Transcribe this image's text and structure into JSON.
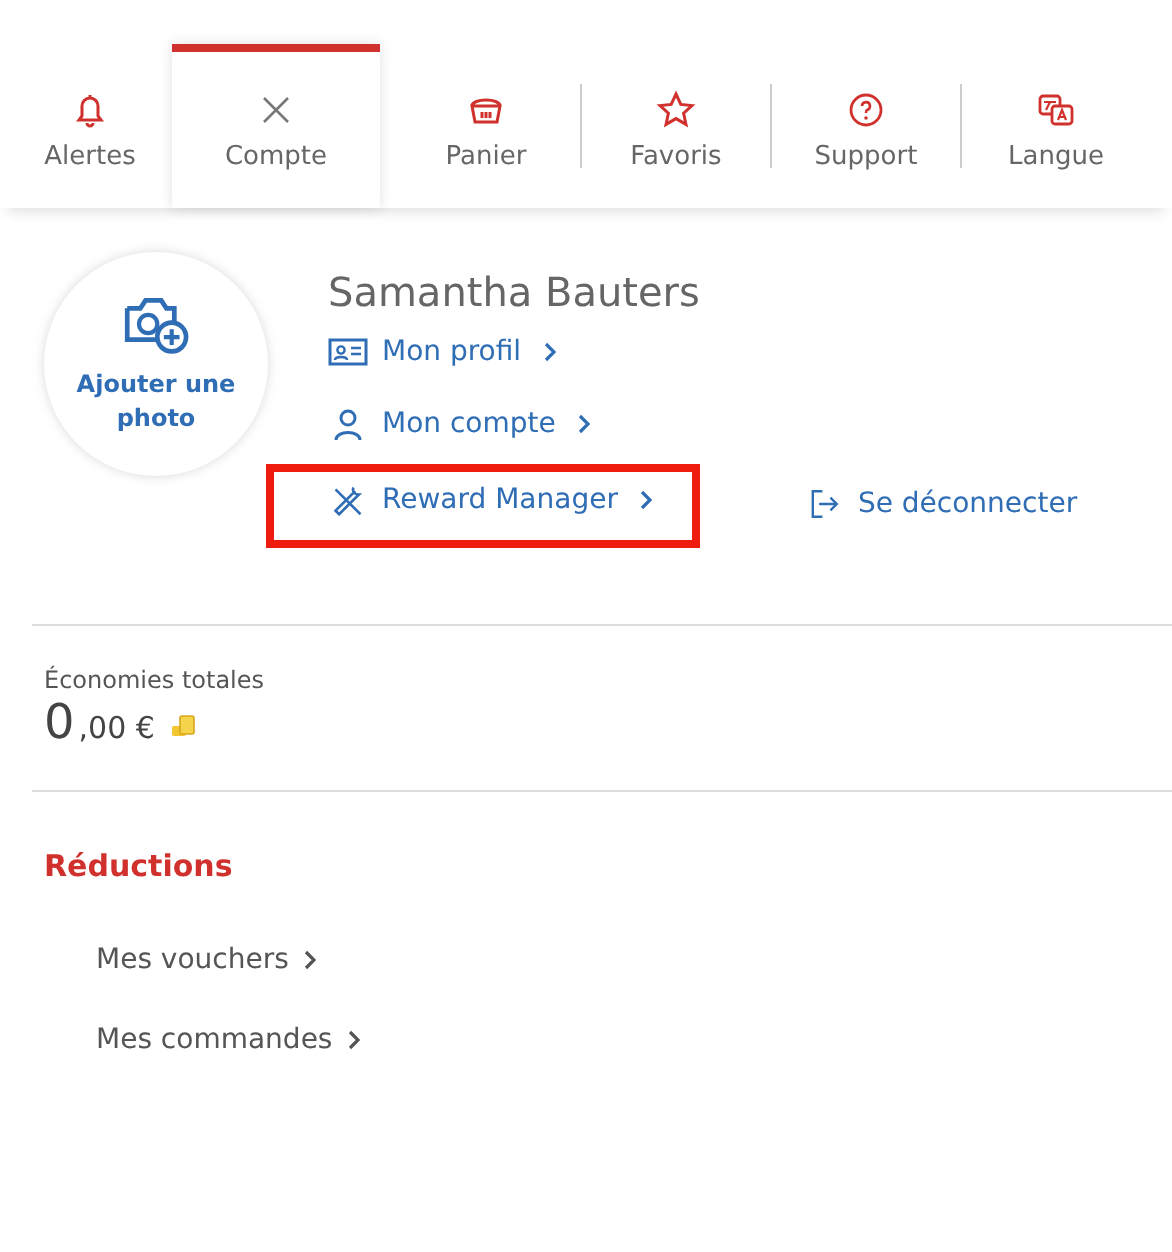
{
  "tabs": [
    {
      "label": "Alertes",
      "selected": false
    },
    {
      "label": "Compte",
      "selected": true
    },
    {
      "label": "Panier",
      "selected": false
    },
    {
      "label": "Favoris",
      "selected": false
    },
    {
      "label": "Support",
      "selected": false
    },
    {
      "label": "Langue",
      "selected": false
    }
  ],
  "profile": {
    "photo_label": "Ajouter une photo",
    "name": "Samantha Bauters",
    "links": [
      {
        "label": "Mon profil",
        "highlighted": false
      },
      {
        "label": "Mon compte",
        "highlighted": false
      },
      {
        "label": "Reward Manager",
        "highlighted": true
      }
    ],
    "logout": "Se déconnecter"
  },
  "savings": {
    "label": "Économies totales",
    "amount_integer": "0",
    "amount_decimals": ",00 €"
  },
  "reductions": {
    "title": "Réductions",
    "links": [
      "Mes vouchers",
      "Mes commandes"
    ]
  }
}
